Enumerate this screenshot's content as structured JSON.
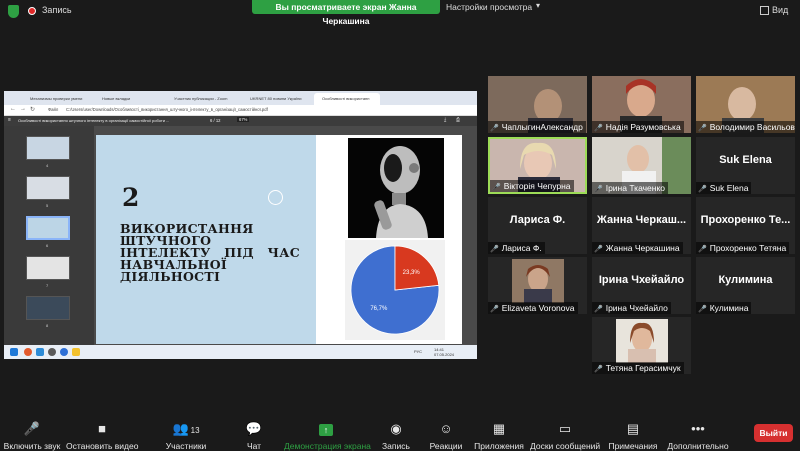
{
  "topbar": {
    "record_label": "Запись",
    "share_banner": "Вы просматриваете экран Жанна Черкашина",
    "view_settings": "Настройки просмотра",
    "view_label": "Вид"
  },
  "browser": {
    "tabs": [
      "Механизмы проверки умени",
      "Новые вкладки",
      "Участник публикации - Zoom",
      "UKRNET 80 новини України",
      "Особливості використанн"
    ],
    "address": "C:/Users/user/Downloads/Особливості_використання_штучного_інтелекту_в_організації_самостійної.pdf",
    "address_prefix": "Файл"
  },
  "pdf": {
    "title": "Особливості використання штучного інтелекту в організації самостійної роботи ...",
    "page": "6 / 12",
    "zoom": "67%",
    "thumb_numbers": [
      "4",
      "5",
      "6",
      "7",
      "8"
    ],
    "slide_number": "2",
    "slide_title": "ВИКОРИСТАННЯ ШТУЧНОГО ІНТЕЛЕКТУ ПІД ЧАС НАВЧАЛЬНОЇ ДІЯЛЬНОСТІ"
  },
  "chart_data": {
    "type": "pie",
    "values": [
      76.7,
      23.3
    ],
    "labels": [
      "76,7%",
      "23,3%"
    ],
    "colors": [
      "#3f6fd0",
      "#d8391f"
    ]
  },
  "taskbar": {
    "time": "14:41",
    "date": "07.05.2024",
    "lang": "РУС"
  },
  "participants": [
    {
      "name": "ЧаплыгинАлександр",
      "video": true
    },
    {
      "name": "Надія Разумовська",
      "video": true
    },
    {
      "name": "Володимир Васильов...",
      "video": true
    },
    {
      "name": "Вікторія Чепурна",
      "video": true,
      "active": true
    },
    {
      "name": "Ірина Ткаченко",
      "video": true
    },
    {
      "name": "Suk Elena",
      "big": "Suk Elena"
    },
    {
      "name": "Лариса Ф.",
      "big": "Лариса Ф."
    },
    {
      "name": "Жанна Черкашина",
      "big": "Жанна Черкаш..."
    },
    {
      "name": "Прохоренко Тетяна",
      "big": "Прохоренко Те..."
    },
    {
      "name": "Elizaveta Voronova",
      "video": true
    },
    {
      "name": "Ірина Чхейайло",
      "big": "Ірина Чхейайло"
    },
    {
      "name": "Кулимина",
      "big": "Кулимина"
    },
    {
      "name": "Тетяна Герасимчук",
      "video": true
    }
  ],
  "toolbar": {
    "unmute": "Включить звук",
    "stop_video": "Остановить видео",
    "participants": "Участники",
    "participants_count": "13",
    "chat": "Чат",
    "share_screen": "Демонстрация экрана",
    "record": "Запись",
    "reactions": "Реакции",
    "apps": "Приложения",
    "whiteboards": "Доски сообщений",
    "notes": "Примечания",
    "more": "Дополнительно",
    "leave": "Выйти"
  },
  "colors": {
    "share_green": "#2ea043",
    "leave_red": "#d63030",
    "mic_muted_red": "#e34b4b",
    "active_speaker": "#9ddc57"
  }
}
